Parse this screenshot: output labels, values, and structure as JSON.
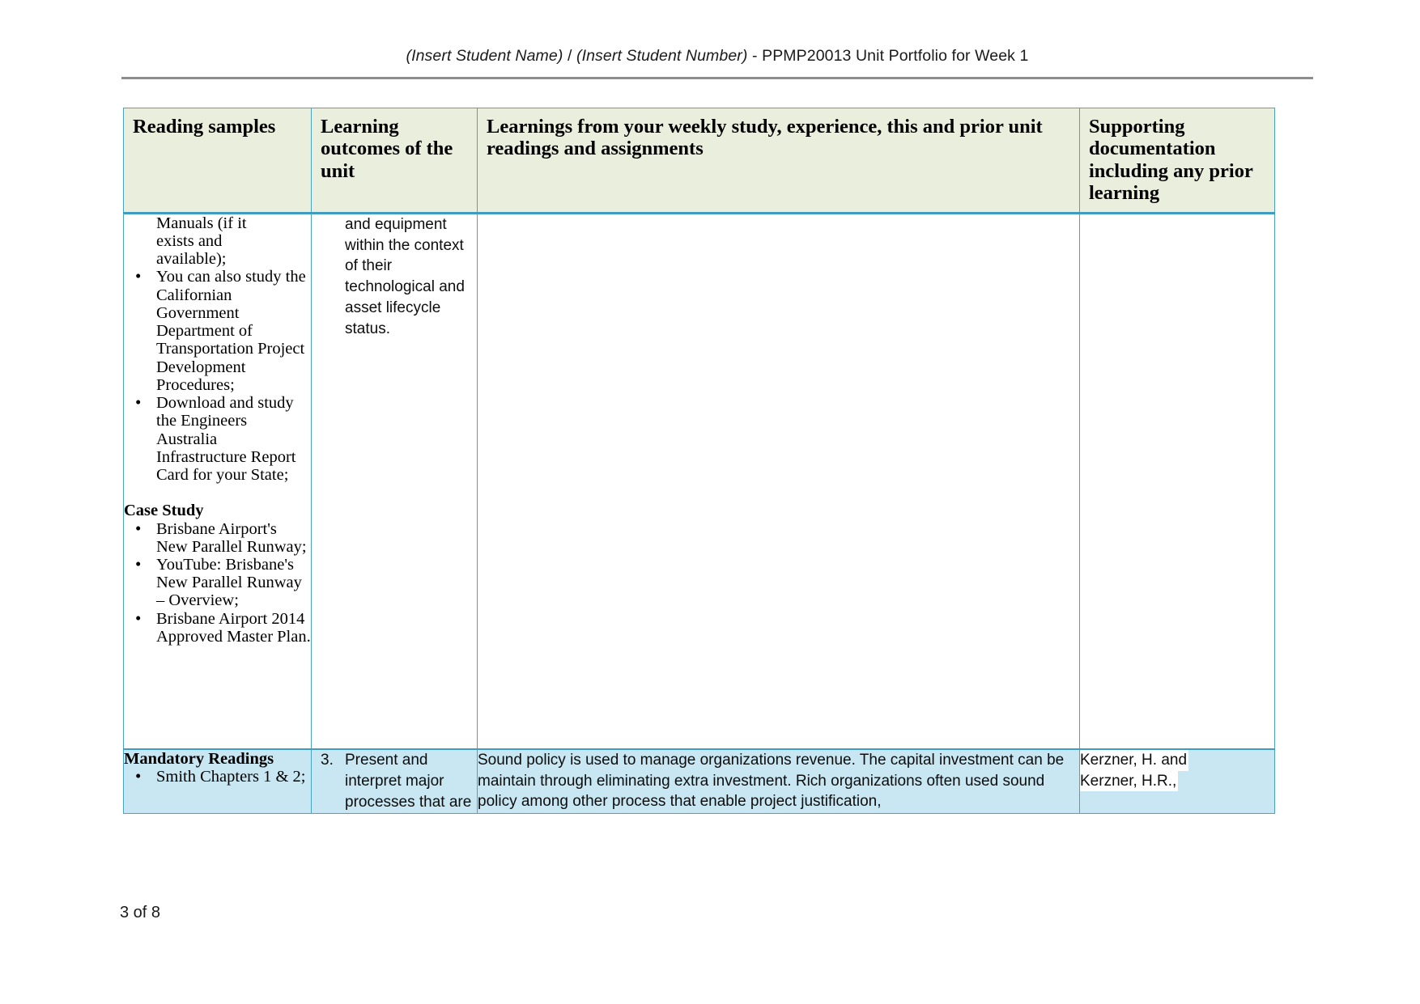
{
  "document": {
    "header": {
      "student_name_placeholder": "(Insert Student Name)",
      "separator": " / ",
      "student_number_placeholder": "(Insert Student Number)",
      "title_suffix": " - PPMP20013 Unit Portfolio for Week 1",
      "full_text": "(Insert Student Name) / (Insert Student Number) - PPMP20013 Unit Portfolio for Week 1"
    },
    "page_number": "3 of 8",
    "colors": {
      "header_row_background": "#eaeedc",
      "table_border": "#4ba3c3",
      "highlight_row_background": "#c9e7f2",
      "header_rule": "#8d8d8d"
    }
  },
  "table": {
    "columns": [
      {
        "label": "Reading samples"
      },
      {
        "label": "Learning outcomes of the unit"
      },
      {
        "label": "Learnings from your weekly study, experience, this and prior unit readings and assignments"
      },
      {
        "label": "Supporting documentation including any prior learning"
      }
    ],
    "rows": [
      {
        "reading_samples": {
          "continuation_lines": [
            "Manuals (if it",
            "exists and",
            "available);"
          ],
          "bullets": [
            "You can also study the Californian Government Department of Transportation Project Development Procedures;",
            "Download and study the Engineers Australia Infrastructure Report Card for your State;"
          ],
          "section_heading": "Case Study",
          "case_study_bullets": [
            "Brisbane Airport's New Parallel Runway;",
            "YouTube: Brisbane's New Parallel Runway – Overview;",
            "Brisbane Airport 2014 Approved Master Plan."
          ]
        },
        "learning_outcomes": "and equipment within the context of their technological and asset lifecycle status.",
        "learnings": "",
        "supporting_documentation": ""
      },
      {
        "reading_samples_heading": "Mandatory Readings",
        "reading_samples_bullets": [
          "Smith Chapters 1 & 2;"
        ],
        "learning_outcome_number": "3.",
        "learning_outcome_text": "Present and interpret major processes that are",
        "learnings": "Sound policy is used to manage organizations revenue. The capital investment can be maintain through eliminating extra investment. Rich organizations often used sound policy among other process  that enable project justification,",
        "supporting_documentation_line1": "Kerzner, H. and",
        "supporting_documentation_line2": "Kerzner, H.R.,"
      }
    ]
  }
}
